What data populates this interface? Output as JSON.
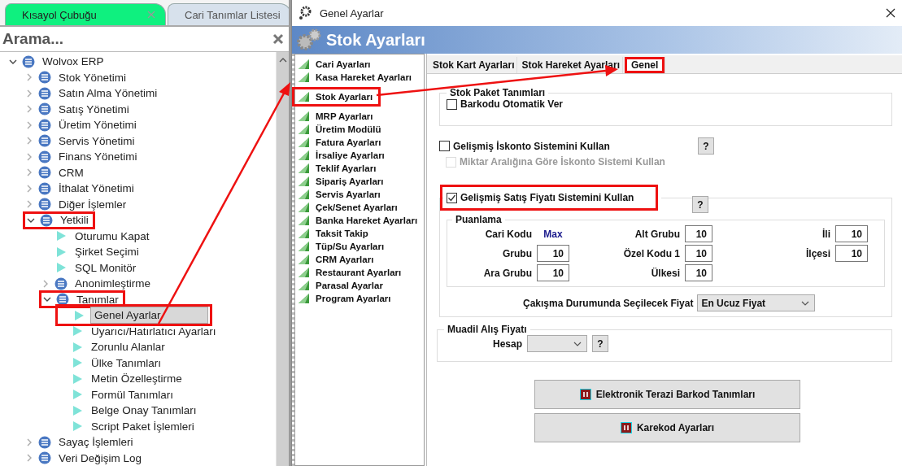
{
  "left_panel": {
    "tabs": [
      {
        "label": "Kısayol Çubuğu",
        "selected": true,
        "closable": true
      },
      {
        "label": "Cari Tanımlar Listesi",
        "selected": false,
        "closable": false
      }
    ],
    "search": {
      "title": "Arama..."
    },
    "tree": [
      {
        "label": "Wolvox ERP",
        "kind": "group",
        "expanded": true,
        "selected": false,
        "highlighted": false,
        "children": [
          {
            "label": "Stok Yönetimi",
            "kind": "group",
            "expanded": false,
            "selected": false,
            "highlighted": false
          },
          {
            "label": "Satın Alma Yönetimi",
            "kind": "group",
            "expanded": false,
            "selected": false,
            "highlighted": false
          },
          {
            "label": "Satış Yönetimi",
            "kind": "group",
            "expanded": false,
            "selected": false,
            "highlighted": false
          },
          {
            "label": "Üretim Yönetimi",
            "kind": "group",
            "expanded": false,
            "selected": false,
            "highlighted": false
          },
          {
            "label": "Servis Yönetimi",
            "kind": "group",
            "expanded": false,
            "selected": false,
            "highlighted": false
          },
          {
            "label": "Finans Yönetimi",
            "kind": "group",
            "expanded": false,
            "selected": false,
            "highlighted": false
          },
          {
            "label": "CRM",
            "kind": "group",
            "expanded": false,
            "selected": false,
            "highlighted": false
          },
          {
            "label": "İthalat Yönetimi",
            "kind": "group",
            "expanded": false,
            "selected": false,
            "highlighted": false
          },
          {
            "label": "Diğer İşlemler",
            "kind": "group",
            "expanded": false,
            "selected": false,
            "highlighted": false
          },
          {
            "label": "Yetkili",
            "kind": "group",
            "expanded": true,
            "selected": false,
            "highlighted": true,
            "children": [
              {
                "label": "Oturumu Kapat",
                "kind": "leaf",
                "selected": false,
                "highlighted": false
              },
              {
                "label": "Şirket Seçimi",
                "kind": "leaf",
                "selected": false,
                "highlighted": false
              },
              {
                "label": "SQL Monitör",
                "kind": "leaf",
                "selected": false,
                "highlighted": false
              },
              {
                "label": "Anonimleştirme",
                "kind": "group",
                "expanded": false,
                "selected": false,
                "highlighted": false
              },
              {
                "label": "Tanımlar",
                "kind": "group",
                "expanded": true,
                "selected": false,
                "highlighted": true,
                "children": [
                  {
                    "label": "Genel Ayarlar",
                    "kind": "leaf",
                    "selected": true,
                    "highlighted": true
                  },
                  {
                    "label": "Uyarıcı/Hatırlatıcı Ayarları",
                    "kind": "leaf",
                    "selected": false,
                    "highlighted": false
                  },
                  {
                    "label": "Zorunlu Alanlar",
                    "kind": "leaf",
                    "selected": false,
                    "highlighted": false
                  },
                  {
                    "label": "Ülke Tanımları",
                    "kind": "leaf",
                    "selected": false,
                    "highlighted": false
                  },
                  {
                    "label": "Metin Özelleştirme",
                    "kind": "leaf",
                    "selected": false,
                    "highlighted": false
                  },
                  {
                    "label": "Formül Tanımları",
                    "kind": "leaf",
                    "selected": false,
                    "highlighted": false
                  },
                  {
                    "label": "Belge Onay Tanımları",
                    "kind": "leaf",
                    "selected": false,
                    "highlighted": false
                  },
                  {
                    "label": "Script Paket İşlemleri",
                    "kind": "leaf",
                    "selected": false,
                    "highlighted": false
                  }
                ]
              }
            ]
          },
          {
            "label": "Sayaç İşlemleri",
            "kind": "group",
            "expanded": false,
            "selected": false,
            "highlighted": false
          },
          {
            "label": "Veri Değişim Log",
            "kind": "group",
            "expanded": false,
            "selected": false,
            "highlighted": false
          }
        ]
      }
    ]
  },
  "dialog": {
    "title": "Genel Ayarlar",
    "header": "Stok Ayarları",
    "nav": [
      {
        "label": "Cari Ayarları",
        "highlighted": false
      },
      {
        "label": "Kasa Hareket Ayarları",
        "highlighted": false
      },
      {
        "label": "Stok Ayarları",
        "highlighted": true
      },
      {
        "label": "MRP Ayarları",
        "highlighted": false
      },
      {
        "label": "Üretim Modülü",
        "highlighted": false
      },
      {
        "label": "Fatura Ayarları",
        "highlighted": false
      },
      {
        "label": "İrsaliye Ayarları",
        "highlighted": false
      },
      {
        "label": "Teklif Ayarları",
        "highlighted": false
      },
      {
        "label": "Sipariş Ayarları",
        "highlighted": false
      },
      {
        "label": "Servis Ayarları",
        "highlighted": false
      },
      {
        "label": "Çek/Senet Ayarları",
        "highlighted": false
      },
      {
        "label": "Banka Hareket Ayarları",
        "highlighted": false
      },
      {
        "label": "Taksit Takip",
        "highlighted": false
      },
      {
        "label": "Tüp/Su Ayarları",
        "highlighted": false
      },
      {
        "label": "CRM Ayarları",
        "highlighted": false
      },
      {
        "label": "Restaurant Ayarları",
        "highlighted": false
      },
      {
        "label": "Parasal Ayarlar",
        "highlighted": false
      },
      {
        "label": "Program Ayarları",
        "highlighted": false
      }
    ],
    "tabs": [
      {
        "label": "Stok Kart Ayarları",
        "selected": false,
        "highlighted": false
      },
      {
        "label": "Stok Hareket Ayarları",
        "selected": false,
        "highlighted": false
      },
      {
        "label": "Genel",
        "selected": true,
        "highlighted": true
      }
    ],
    "stock_package": {
      "title": "Stok Paket Tanımları",
      "checkbox": {
        "label": "Barkodu Otomatik Ver",
        "checked": false
      }
    },
    "discount": {
      "help": "?",
      "checkboxes": [
        {
          "label": "Gelişmiş İskonto Sistemini Kullan",
          "checked": false,
          "disabled": false
        },
        {
          "label": "Miktar Aralığına Göre İskonto Sistemi Kullan",
          "checked": false,
          "disabled": true
        }
      ]
    },
    "sales_price": {
      "label": "Gelişmiş Satış Fiyatı Sistemini Kullan",
      "checked": true,
      "highlighted": true,
      "help": "?",
      "scoring": {
        "title": "Puanlama",
        "rows": [
          [
            {
              "label": "Cari Kodu",
              "value": "Max",
              "kind": "text"
            },
            {
              "label": "Alt Grubu",
              "value": "10",
              "kind": "input"
            },
            {
              "label": "İli",
              "value": "10",
              "kind": "input"
            }
          ],
          [
            {
              "label": "Grubu",
              "value": "10",
              "kind": "input"
            },
            {
              "label": "Özel Kodu 1",
              "value": "10",
              "kind": "input"
            },
            {
              "label": "İlçesi",
              "value": "10",
              "kind": "input"
            }
          ],
          [
            {
              "label": "Ara Grubu",
              "value": "10",
              "kind": "input"
            },
            {
              "label": "Ülkesi",
              "value": "10",
              "kind": "input"
            }
          ]
        ]
      },
      "conflict": {
        "label": "Çakışma Durumunda Seçilecek Fiyat",
        "value": "En Ucuz Fiyat"
      }
    },
    "equivalent": {
      "title": "Muadil Alış Fiyatı",
      "field_label": "Hesap",
      "help": "?"
    },
    "buttons": [
      {
        "label": "Elektronik Terazi Barkod Tanımları"
      },
      {
        "label": "Karekod Ayarları"
      }
    ]
  }
}
